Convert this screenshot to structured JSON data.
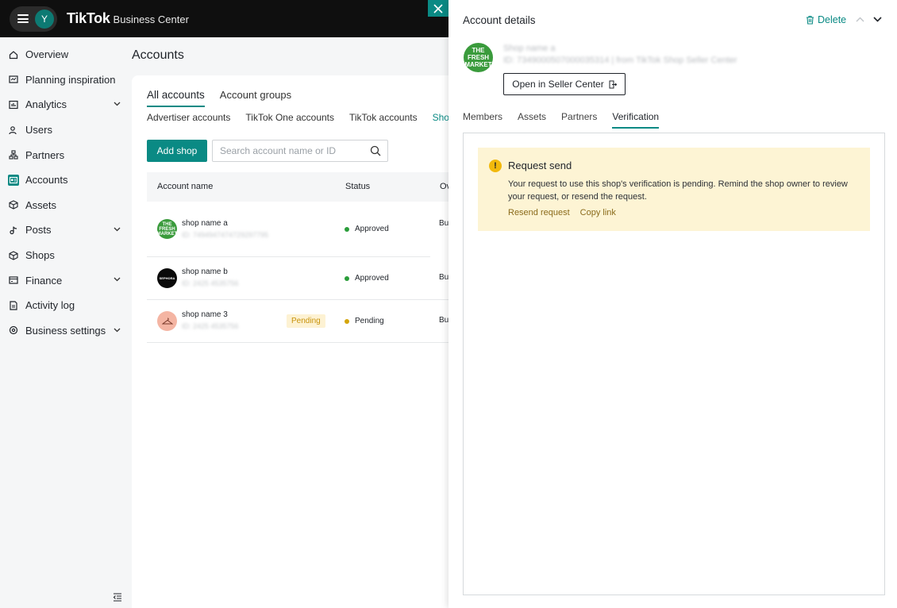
{
  "header": {
    "avatar_initial": "Y",
    "brand": "TikTok",
    "brand_sub": "Business Center"
  },
  "sidebar": {
    "items": [
      {
        "label": "Overview",
        "icon": "home-icon"
      },
      {
        "label": "Planning inspiration",
        "icon": "planning-icon"
      },
      {
        "label": "Analytics",
        "icon": "analytics-icon",
        "expandable": true
      },
      {
        "label": "Users",
        "icon": "users-icon"
      },
      {
        "label": "Partners",
        "icon": "partners-icon"
      },
      {
        "label": "Accounts",
        "icon": "accounts-icon",
        "active": true
      },
      {
        "label": "Assets",
        "icon": "assets-icon"
      },
      {
        "label": "Posts",
        "icon": "posts-icon",
        "expandable": true
      },
      {
        "label": "Shops",
        "icon": "shops-icon"
      },
      {
        "label": "Finance",
        "icon": "finance-icon",
        "expandable": true
      },
      {
        "label": "Activity log",
        "icon": "activity-log-icon"
      },
      {
        "label": "Business settings",
        "icon": "settings-icon",
        "expandable": true
      }
    ]
  },
  "main": {
    "title": "Accounts",
    "tabs": [
      {
        "label": "All accounts",
        "active": true
      },
      {
        "label": "Account groups"
      }
    ],
    "subtabs": [
      "Advertiser accounts",
      "TikTok One accounts",
      "TikTok accounts",
      "Sho"
    ],
    "add_shop_label": "Add shop",
    "search_placeholder": "Search account name or ID",
    "table": {
      "headers": [
        "Account name",
        "Status",
        "Ov"
      ],
      "rows": [
        {
          "name": "shop name a",
          "id": "ID: 7494947474729297795",
          "status": "Approved",
          "owner": "Bu",
          "status_color": "#2a9d3a"
        },
        {
          "name": "shop name b",
          "id": "ID: 2425 4535756",
          "status": "Approved",
          "owner": "Bu",
          "status_color": "#2a9d3a"
        },
        {
          "name": "shop name 3",
          "id": "ID: 2425 4535756",
          "status": "Pending",
          "owner": "Bu",
          "badge": "Pending",
          "status_color": "#d4a50b"
        }
      ]
    }
  },
  "drawer": {
    "title": "Account details",
    "delete_label": "Delete",
    "shop_name": "Shop name a",
    "shop_id_line": "ID: 7349000507000035314  |  from TikTok Shop Seller Center",
    "logo_text": "THE FRESH MARKET",
    "open_seller_label": "Open in Seller Center",
    "tabs": [
      "Members",
      "Assets",
      "Partners",
      "Verification"
    ],
    "active_tab": "Verification",
    "alert": {
      "title": "Request send",
      "body": "Your request to use this shop's verification is pending. Remind the shop owner to review your request, or resend the request.",
      "links": [
        "Resend request",
        "Copy link"
      ]
    }
  },
  "colors": {
    "accent": "#0a8a84",
    "approved": "#2a9d3a",
    "pending": "#d4a50b",
    "alert_bg": "#fdf4d4"
  }
}
